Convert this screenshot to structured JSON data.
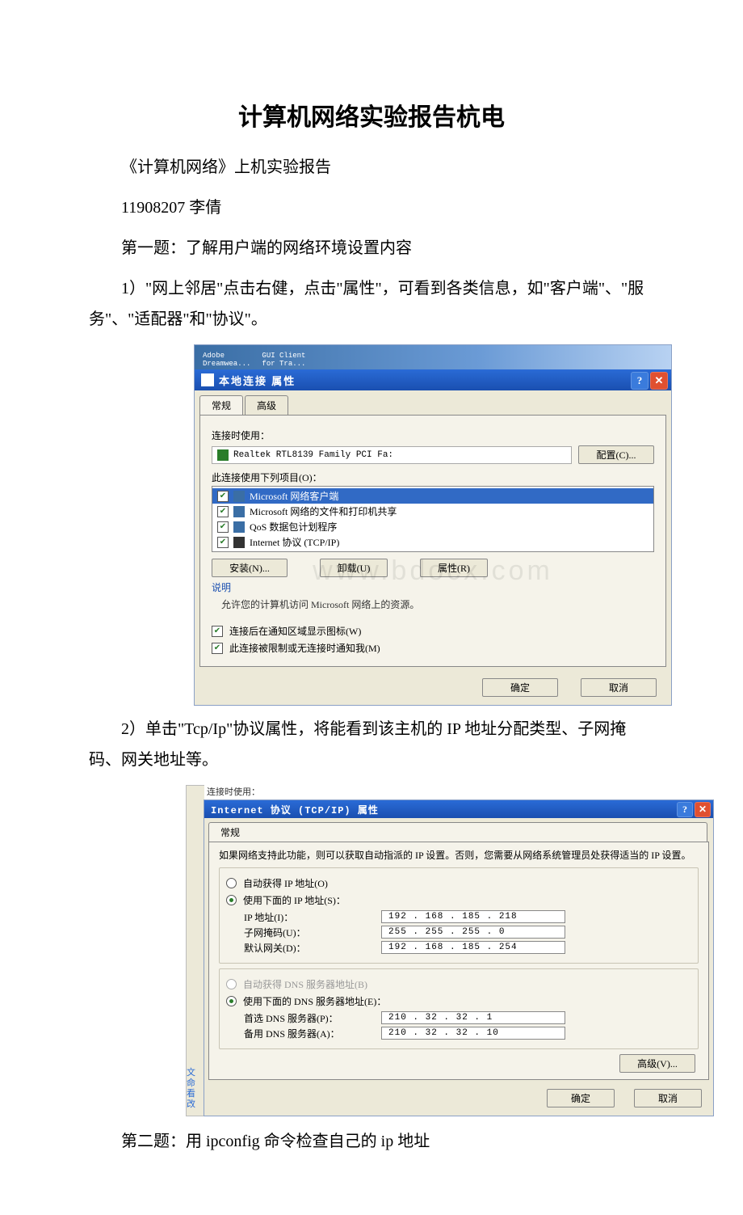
{
  "doc": {
    "title": "计算机网络实验报告杭电",
    "p1": "《计算机网络》上机实验报告",
    "p2": "11908207 李倩",
    "p3": "第一题：了解用户端的网络环境设置内容",
    "p4": "1）\"网上邻居\"点击右健，点击\"属性\"，可看到各类信息，如\"客户端\"、\"服务\"、\"适配器\"和\"协议\"。",
    "p5": "2）单击\"Tcp/Ip\"协议属性，将能看到该主机的 IP 地址分配类型、子网掩码、网关地址等。",
    "p6": "第二题：用 ipconfig 命令检查自己的 ip 地址"
  },
  "fig1": {
    "desktop_icon1a": "Adobe",
    "desktop_icon1b": "Dreamwea...",
    "desktop_icon2a": "GUI Client",
    "desktop_icon2b": "for Tra...",
    "window_title": "本地连接  属性",
    "help": "?",
    "close": "✕",
    "tab1": "常规",
    "tab2": "高级",
    "lbl_connect": "连接时使用：",
    "adapter": "Realtek RTL8139 Family PCI Fa:",
    "btn_config": "配置(C)...",
    "lbl_items": "此连接使用下列项目(O)：",
    "item1": "Microsoft 网络客户端",
    "item2": "Microsoft 网络的文件和打印机共享",
    "item3": "QoS 数据包计划程序",
    "item4": "Internet 协议 (TCP/IP)",
    "btn_install": "安装(N)...",
    "btn_uninstall": "卸载(U)",
    "btn_prop": "属性(R)",
    "lbl_desc": "说明",
    "desc_text": "允许您的计算机访问 Microsoft 网络上的资源。",
    "cb1": "连接后在通知区域显示图标(W)",
    "cb2": "此连接被限制或无连接时通知我(M)",
    "btn_ok": "确定",
    "btn_cancel": "取消",
    "watermark": "www.bdocx.com"
  },
  "fig2": {
    "top_label": "连接时使用：",
    "window_title": "Internet 协议 (TCP/IP) 属性",
    "help": "?",
    "close": "✕",
    "tab1": "常规",
    "blurb": "如果网络支持此功能，则可以获取自动指派的 IP 设置。否则，您需要从网络系统管理员处获得适当的 IP 设置。",
    "r1": "自动获得 IP 地址(O)",
    "r2": "使用下面的 IP 地址(S)：",
    "ip_lbl": "IP 地址(I)：",
    "ip_val": "192 . 168 . 185 . 218",
    "mask_lbl": "子网掩码(U)：",
    "mask_val": "255 . 255 . 255 .  0",
    "gw_lbl": "默认网关(D)：",
    "gw_val": "192 . 168 . 185 . 254",
    "r3": "自动获得 DNS 服务器地址(B)",
    "r4": "使用下面的 DNS 服务器地址(E)：",
    "dns1_lbl": "首选 DNS 服务器(P)：",
    "dns1_val": "210 .  32 .  32 .  1",
    "dns2_lbl": "备用 DNS 服务器(A)：",
    "dns2_val": "210 .  32 .  32 . 10",
    "btn_adv": "高级(V)...",
    "btn_ok": "确定",
    "btn_cancel": "取消",
    "side1": "文",
    "side2": "命",
    "side3": "看",
    "side4": "改"
  }
}
